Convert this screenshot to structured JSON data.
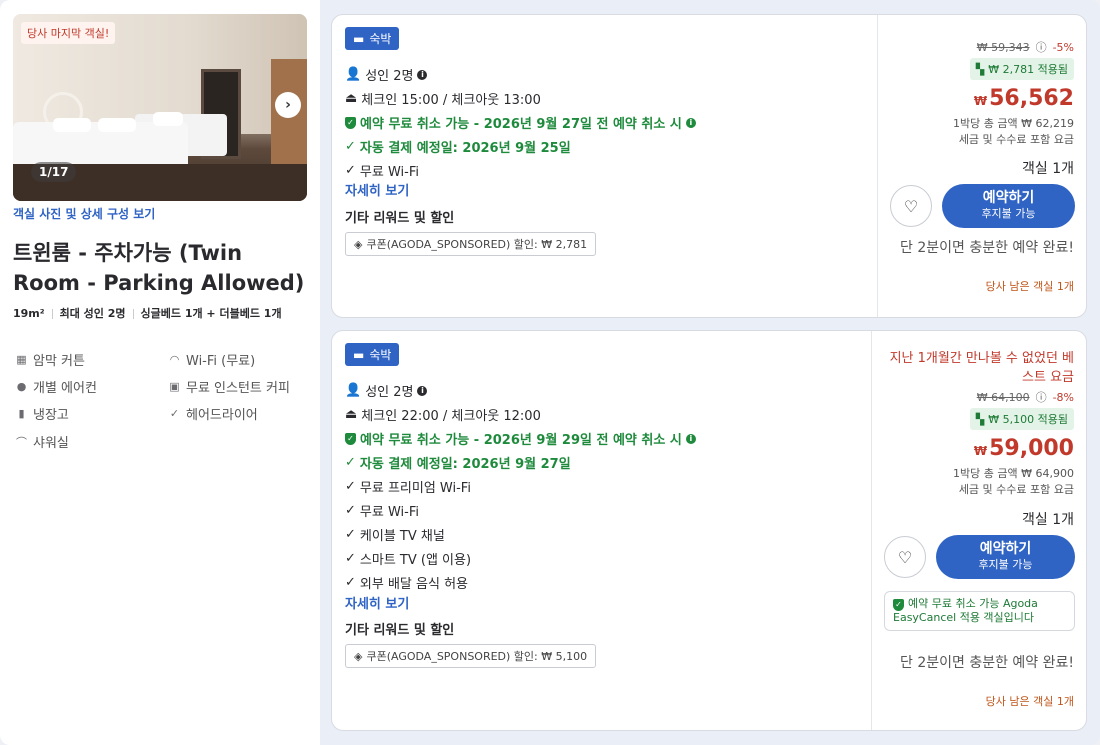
{
  "room": {
    "last_room_badge": "당사 마지막 객실!",
    "photo_counter": "1/17",
    "photo_link": "객실 사진 및 상세 구성 보기",
    "title": "트윈룸 - 주차가능 (Twin Room - Parking Allowed)",
    "size": "19m²",
    "max_guests": "최대 성인 2명",
    "beds": "싱글베드 1개 + 더블베드 1개",
    "amenities": [
      {
        "label": "암막 커튼",
        "icon": "curtain-icon"
      },
      {
        "label": "Wi-Fi (무료)",
        "icon": "wifi-icon"
      },
      {
        "label": "개별 에어컨",
        "icon": "ac-icon"
      },
      {
        "label": "무료 인스턴트 커피",
        "icon": "coffee-icon"
      },
      {
        "label": "냉장고",
        "icon": "fridge-icon"
      },
      {
        "label": "헤어드라이어",
        "icon": "check-icon"
      },
      {
        "label": "샤워실",
        "icon": "shower-icon"
      }
    ]
  },
  "offers": [
    {
      "badge": "숙박",
      "guests": "성인 2명",
      "checkin": "체크인 15:00 / 체크아웃 13:00",
      "free_cancel": "예약 무료 취소 가능 - 2026년 9월 27일 전 예약 취소 시",
      "auto_pay": "자동 결제 예정일: 2026년 9월 25일",
      "features": [
        "무료 Wi-Fi"
      ],
      "details_link": "자세히 보기",
      "rewards_title": "기타 리워드 및 할인",
      "coupon": "쿠폰(AGODA_SPONSORED) 할인: ₩ 2,781",
      "best_price_note": "",
      "original_price": "₩ 59,343",
      "discount_pct": "-5%",
      "applied": "₩ 2,781 적용됨",
      "currency": "₩",
      "price": "56,562",
      "per_night_total": "1박당 총 금액 ₩ 62,219",
      "tax_note": "세금 및 수수료 포함 요금",
      "rooms": "객실 1개",
      "book_label": "예약하기",
      "book_sub": "후지불 가능",
      "easy_cancel": "",
      "enough_time": "단 2분이면 충분한 예약 완료!",
      "rooms_left": "당사 남은 객실 1개"
    },
    {
      "badge": "숙박",
      "guests": "성인 2명",
      "checkin": "체크인 22:00 / 체크아웃 12:00",
      "free_cancel": "예약 무료 취소 가능 - 2026년 9월 29일 전 예약 취소 시",
      "auto_pay": "자동 결제 예정일: 2026년 9월 27일",
      "features": [
        "무료 프리미엄 Wi-Fi",
        "무료 Wi-Fi",
        "케이블 TV 채널",
        "스마트 TV (앱 이용)",
        "외부 배달 음식 허용"
      ],
      "details_link": "자세히 보기",
      "rewards_title": "기타 리워드 및 할인",
      "coupon": "쿠폰(AGODA_SPONSORED) 할인: ₩ 5,100",
      "best_price_note": "지난 1개월간 만나볼 수 없었던 베스트 요금",
      "original_price": "₩ 64,100",
      "discount_pct": "-8%",
      "applied": "₩ 5,100 적용됨",
      "currency": "₩",
      "price": "59,000",
      "per_night_total": "1박당 총 금액 ₩ 64,900",
      "tax_note": "세금 및 수수료 포함 요금",
      "rooms": "객실 1개",
      "book_label": "예약하기",
      "book_sub": "후지불 가능",
      "easy_cancel": "예약 무료 취소 가능 Agoda EasyCancel 적용 객실입니다",
      "enough_time": "단 2분이면 충분한 예약 완료!",
      "rooms_left": "당사 남은 객실 1개"
    }
  ],
  "colors": {
    "accent": "#2f63c4",
    "price": "#c0392b",
    "green": "#1e8a3c"
  }
}
